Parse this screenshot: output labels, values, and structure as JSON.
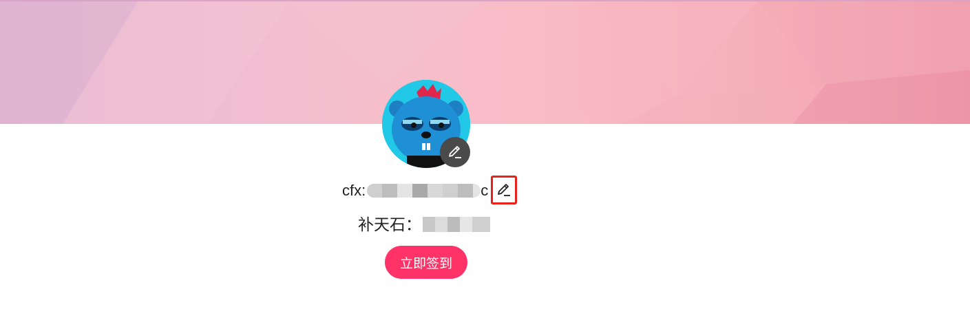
{
  "profile": {
    "address_prefix": "cfx:",
    "address_suffix": "c",
    "points_label": "补天石："
  },
  "actions": {
    "checkin_label": "立即签到"
  },
  "icons": {
    "avatar_edit": "pencil-icon",
    "address_edit": "pencil-icon"
  },
  "colors": {
    "banner_start": "#e3b7d3",
    "banner_end": "#ef97a9",
    "checkin_button": "#ff3368",
    "highlight_box": "#e8201a",
    "avatar_background": "#22c9e6"
  }
}
